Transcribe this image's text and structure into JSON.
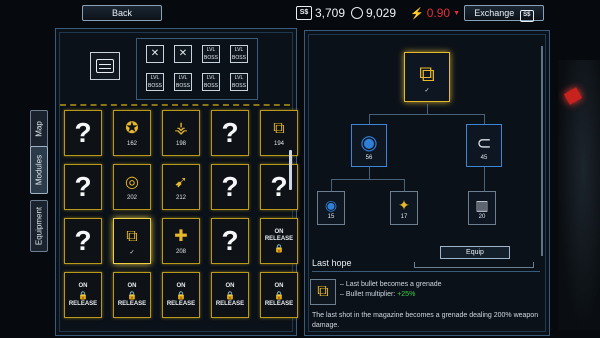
{
  "header": {
    "back_label": "Back",
    "exchange_label": "Exchange",
    "exchange_icon": "S$",
    "money_icon": "S$",
    "money": "3,709",
    "bolts": "9,029",
    "odds": "0.90",
    "odds_arrow": "▼"
  },
  "tabs": [
    {
      "label": "Map"
    },
    {
      "label": "Modules"
    },
    {
      "label": "Equipment"
    }
  ],
  "top_slots": [
    {
      "label": "✕"
    },
    {
      "label": "✕"
    },
    {
      "label": "LVL BOSS"
    },
    {
      "label": "LVL BOSS"
    },
    {
      "label": "LVL BOSS"
    },
    {
      "label": "LVL BOSS"
    },
    {
      "label": "LVL BOSS"
    },
    {
      "label": "LVL BOSS"
    }
  ],
  "grid": [
    [
      {
        "kind": "q"
      },
      {
        "kind": "icon",
        "glyph": "✪",
        "count": "162"
      },
      {
        "kind": "icon",
        "glyph": "⚶",
        "count": "198"
      },
      {
        "kind": "q"
      },
      {
        "kind": "icon",
        "glyph": "⧉",
        "count": "194"
      }
    ],
    [
      {
        "kind": "q"
      },
      {
        "kind": "icon",
        "glyph": "◎",
        "count": "202"
      },
      {
        "kind": "icon",
        "glyph": "➹",
        "count": "212"
      },
      {
        "kind": "q"
      },
      {
        "kind": "q"
      }
    ],
    [
      {
        "kind": "q"
      },
      {
        "kind": "icon",
        "glyph": "⧉",
        "count": "✓"
      },
      {
        "kind": "icon",
        "glyph": "✚",
        "count": "208"
      },
      {
        "kind": "q"
      },
      {
        "kind": "release",
        "line1": "ON",
        "line2": "RELEASE"
      }
    ],
    [
      {
        "kind": "release",
        "line1": "ON",
        "line2": "RELEASE"
      },
      {
        "kind": "release",
        "line1": "ON",
        "line2": "RELEASE"
      },
      {
        "kind": "release",
        "line1": "ON",
        "line2": "RELEASE"
      },
      {
        "kind": "release",
        "line1": "ON",
        "line2": "RELEASE"
      },
      {
        "kind": "release",
        "line1": "ON",
        "line2": "RELEASE"
      }
    ]
  ],
  "tree": {
    "root": {
      "glyph": "⧉",
      "count": "✓"
    },
    "left": {
      "glyph": "◉",
      "count": "56"
    },
    "right": {
      "glyph": "⊂",
      "count": "45"
    },
    "ll": {
      "glyph": "◉",
      "count": "15"
    },
    "lm": {
      "glyph": "✦",
      "count": "17"
    },
    "rr": {
      "glyph": "▥",
      "count": "20"
    }
  },
  "detail": {
    "equip_label": "Equip",
    "title": "Last hope",
    "line1": "– Last bullet becomes a grenade",
    "line2_prefix": "– Bullet multiplier: ",
    "line2_value": "+25%",
    "description": "The last shot in the magazine becomes a grenade dealing 200% weapon damage."
  },
  "colors": {
    "gold": "#e7b92a",
    "blue": "#3d86d6",
    "green": "#3bd04a",
    "red": "#e0303a"
  }
}
